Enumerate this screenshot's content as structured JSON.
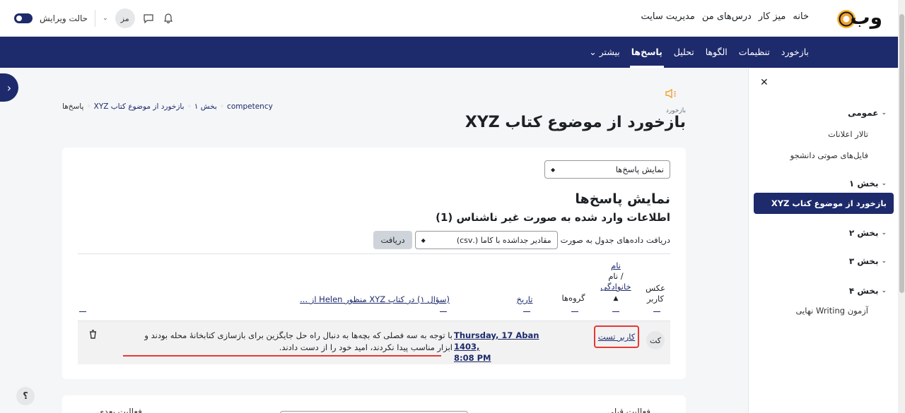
{
  "header": {
    "logo_text": "وب",
    "nav": [
      "خانه",
      "میز کار",
      "درس‌های من",
      "مدیریت سایت"
    ],
    "edit_mode_label": "حالت ویرایش",
    "user_initials": "مز"
  },
  "secnav": {
    "items": [
      {
        "label": "بازخورد",
        "active": false
      },
      {
        "label": "تنظیمات",
        "active": false
      },
      {
        "label": "الگوها",
        "active": false
      },
      {
        "label": "تحلیل",
        "active": false
      },
      {
        "label": "پاسخ‌ها",
        "active": true
      },
      {
        "label": "بیشتر ⌄",
        "active": false
      }
    ]
  },
  "drawer": {
    "general": "عمومی",
    "general_items": [
      "تالار اعلانات",
      "فایل‌های صوتی دانشجو"
    ],
    "section1": "بخش ۱",
    "active_item": "بازخورد از موضوع کتاب XYZ",
    "section2": "بخش ۲",
    "section3": "بخش ۳",
    "section4": "بخش ۴",
    "section4_item": "آزمون Writing نهایی"
  },
  "breadcrumb": [
    "competency",
    "بخش ۱",
    "بازخورد از موضوع کتاب XYZ",
    "پاسخ‌ها"
  ],
  "module": {
    "type": "بازخورد",
    "title": "بازخورد از موضوع کتاب XYZ"
  },
  "card": {
    "view_select": "نمایش پاسخ‌ها",
    "heading": "نمایش پاسخ‌ها",
    "subheading": "اطلاعات وارد شده به صورت غیر ناشناس (1)",
    "download_label": "دریافت داده‌های جدول به صورت",
    "download_format": "مقادیر جداشده با کاما (.csv)",
    "download_button": "دریافت"
  },
  "table": {
    "headers": {
      "picture": "عکس کاربر",
      "name_line1": "نام",
      "name_line2": "/ نام",
      "name_line3": "خانوادگی",
      "groups": "گروه‌ها",
      "date": "تاریخ",
      "question": "(سؤال ۱) در کتاب XYZ منظور Helen از ..."
    },
    "row": {
      "avatar": "کت",
      "user": "کاربر تست",
      "date_line1": "Thursday, 17 Aban 1403,",
      "date_line2": "8:08 PM",
      "answer": "با توجه به سه فصلی که بچه‌ها به دنبال راه حل جایگزین برای بازسازی کتابخانهٔ محله بودند و ابزار مناسب پیدا نکردند، امید خود را از دست دادند."
    }
  },
  "bottom": {
    "prev": "فعالیت قبلی",
    "next": "فعالیت بعدی"
  },
  "help": "؟"
}
